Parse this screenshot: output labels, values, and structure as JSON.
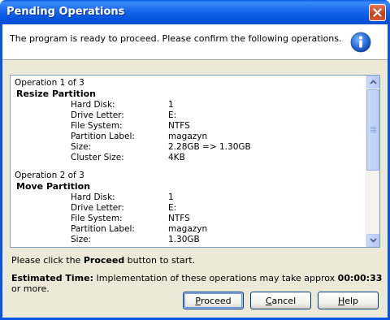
{
  "window": {
    "title": "Pending Operations"
  },
  "header": {
    "message": "The program is ready to proceed. Please confirm the following operations.",
    "icon": "info-icon"
  },
  "operations": [
    {
      "title": "Operation 1 of 3",
      "name": "Resize Partition",
      "properties": [
        {
          "label": "Hard Disk:",
          "value": "1"
        },
        {
          "label": "Drive Letter:",
          "value": "E:"
        },
        {
          "label": "File System:",
          "value": "NTFS"
        },
        {
          "label": "Partition Label:",
          "value": "magazyn"
        },
        {
          "label": "Size:",
          "value": "2.28GB => 1.30GB"
        },
        {
          "label": "Cluster Size:",
          "value": "4KB"
        }
      ]
    },
    {
      "title": "Operation 2 of 3",
      "name": "Move Partition",
      "properties": [
        {
          "label": "Hard Disk:",
          "value": "1"
        },
        {
          "label": "Drive Letter:",
          "value": "E:"
        },
        {
          "label": "File System:",
          "value": "NTFS"
        },
        {
          "label": "Partition Label:",
          "value": "magazyn"
        },
        {
          "label": "Size:",
          "value": "1.30GB"
        }
      ]
    }
  ],
  "footer": {
    "click_prefix": "Please click the ",
    "click_bold": "Proceed",
    "click_suffix": " button to start.",
    "est_label": "Estimated Time:",
    "est_text": " Implementation of these operations may take approx ",
    "est_time": "00:00:33",
    "est_suffix": " or more."
  },
  "buttons": {
    "proceed_mnemonic": "P",
    "proceed_rest": "roceed",
    "cancel_mnemonic": "C",
    "cancel_rest": "ancel",
    "help_mnemonic": "H",
    "help_rest": "elp"
  },
  "colors": {
    "titlebar": "#0a55e3",
    "dialog_bg": "#ece9d8",
    "close_button": "#c4401b"
  }
}
